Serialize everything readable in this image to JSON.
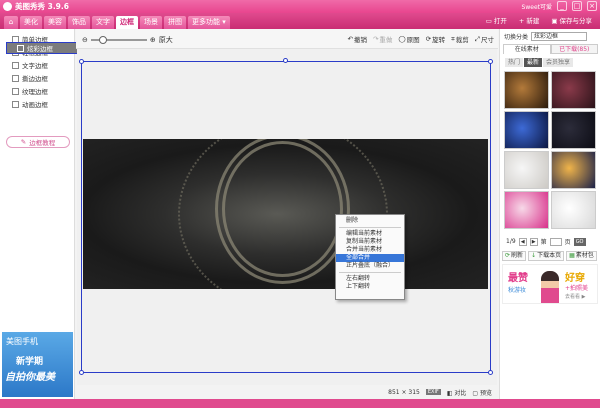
{
  "app": {
    "title": "美图秀秀 3.9.6",
    "user": "Sweet可爱"
  },
  "titlebar_buttons": [
    "_",
    "□",
    "×"
  ],
  "menu": {
    "home_label": "⌂",
    "tabs": [
      "美化",
      "美容",
      "饰品",
      "文字",
      "边框",
      "场景",
      "拼图",
      "更多功能 ▾"
    ],
    "active_tab": 4,
    "actions": [
      {
        "icon": "folder-icon",
        "label": "打开"
      },
      {
        "icon": "plus-icon",
        "label": "新建"
      },
      {
        "icon": "save-icon",
        "label": "保存与分享"
      }
    ]
  },
  "left_panel": {
    "items": [
      "简单边框",
      "轻松边框",
      "文字边框",
      "撕边边框",
      "炫彩边框",
      "纹理边框",
      "动画边框"
    ],
    "selected_index": 4,
    "tutorial": "边框教程"
  },
  "left_ad": {
    "line1": "美图手机",
    "line2": "新学期",
    "line3": "自拍你最美"
  },
  "toolbar": {
    "zoom_label": "原大",
    "tools": [
      {
        "icon": "undo-icon",
        "label": "撤销",
        "enabled": true
      },
      {
        "icon": "redo-icon",
        "label": "重做",
        "enabled": false
      },
      {
        "icon": "original-icon",
        "label": "原图",
        "enabled": true
      },
      {
        "icon": "rotate-icon",
        "label": "旋转",
        "enabled": true
      },
      {
        "icon": "crop-icon",
        "label": "裁剪",
        "enabled": true
      },
      {
        "icon": "resize-icon",
        "label": "尺寸",
        "enabled": true
      }
    ]
  },
  "context_menu": {
    "items": [
      {
        "label": "删除",
        "sep_after": true
      },
      {
        "label": "编辑当前素材"
      },
      {
        "label": "复制当前素材"
      },
      {
        "label": "合并当前素材"
      },
      {
        "label": "全部合并",
        "highlighted": true
      },
      {
        "label": "正片叠底（融合）",
        "sep_after": true
      },
      {
        "label": "左右翻转"
      },
      {
        "label": "上下翻转"
      }
    ]
  },
  "status": {
    "dimensions": "851 × 315",
    "badge": "EXIF",
    "compare": "对比",
    "preview": "预览"
  },
  "right_panel": {
    "category_label": "切换分类",
    "category_value": "炫彩边框",
    "tabs": [
      "在线素材",
      "已下载(85)"
    ],
    "subtabs": [
      "热门",
      "最新",
      "会员独享"
    ],
    "active_subtab": 1,
    "thumb_colors": [
      [
        "#2b1a0c",
        "#b37a3a"
      ],
      [
        "#2a1218",
        "#8a3a4a"
      ],
      [
        "#0b1640",
        "#3d6ad6"
      ],
      [
        "#0c0c14",
        "#2c2c3a"
      ],
      [
        "#ccc9c4",
        "#f6f6f6"
      ],
      [
        "#1a2048",
        "#f0b44a"
      ],
      [
        "#d8308a",
        "#f7d9e8"
      ],
      [
        "#d8d8d8",
        "#ffffff"
      ]
    ],
    "pager": {
      "page": "1/9",
      "page_suffix": "页",
      "go": "GO"
    },
    "buttons": [
      {
        "icon": "refresh-icon",
        "label": "刷新"
      },
      {
        "icon": "download-icon",
        "label": "下载本页"
      },
      {
        "icon": "material-icon",
        "label": "素材包"
      }
    ],
    "ad": {
      "text1": "最赞",
      "text2": "秋游妆",
      "text3": "好穿",
      "text4": "+拍照美",
      "text5": "去看看 ▶"
    }
  }
}
